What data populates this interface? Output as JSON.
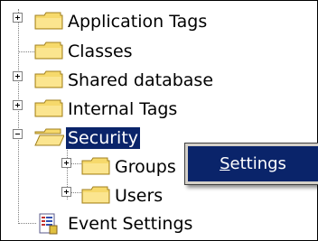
{
  "tree": {
    "items": [
      {
        "label": "Application Tags",
        "expander": "plus",
        "icon": "folder-icon"
      },
      {
        "label": "Classes",
        "expander": "none",
        "icon": "folder-icon"
      },
      {
        "label": "Shared database",
        "expander": "plus",
        "icon": "folder-icon"
      },
      {
        "label": "Internal Tags",
        "expander": "plus",
        "icon": "folder-icon"
      },
      {
        "label": "Security",
        "expander": "minus",
        "icon": "folder-open-icon",
        "selected": true
      },
      {
        "label": "Groups",
        "expander": "plus",
        "icon": "folder-icon"
      },
      {
        "label": "Users",
        "expander": "plus",
        "icon": "folder-icon"
      },
      {
        "label": "Event Settings",
        "expander": "none",
        "icon": "event-settings-icon"
      }
    ]
  },
  "context_menu": {
    "items": [
      {
        "label_underlined": "S",
        "label_rest": "ettings",
        "highlighted": true
      }
    ]
  },
  "colors": {
    "selection": "#0a246a",
    "menu_background": "#d4d0c8",
    "folder": "#f6d96b"
  }
}
